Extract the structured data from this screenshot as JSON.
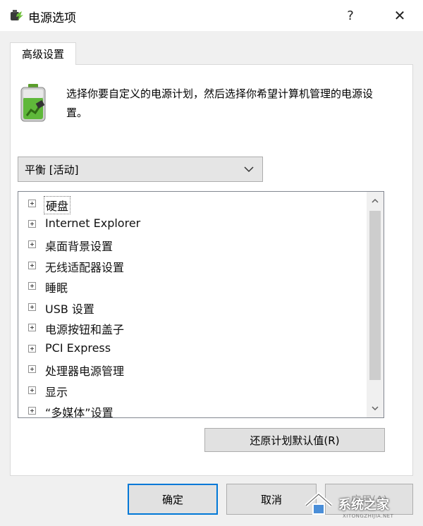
{
  "window": {
    "title": "电源选项",
    "help_label": "?",
    "close_label": "✕",
    "icon": "power-options-icon"
  },
  "tabs": [
    {
      "label": "高级设置",
      "active": true
    }
  ],
  "description": "选择你要自定义的电源计划，然后选择你希望计算机管理的电源设置。",
  "plan_select": {
    "value": "平衡 [活动]",
    "icon": "chevron-down-icon"
  },
  "settings_list": {
    "items": [
      {
        "label": "硬盘"
      },
      {
        "label": "Internet Explorer"
      },
      {
        "label": "桌面背景设置"
      },
      {
        "label": "无线适配器设置"
      },
      {
        "label": "睡眠"
      },
      {
        "label": "USB 设置"
      },
      {
        "label": "电源按钮和盖子"
      },
      {
        "label": "PCI Express"
      },
      {
        "label": "处理器电源管理"
      },
      {
        "label": "显示"
      },
      {
        "label": "“多媒体”设置"
      }
    ]
  },
  "buttons": {
    "restore_label": "还原计划默认值(R)",
    "ok_label": "确定",
    "cancel_label": "取消",
    "apply_label": "应用(A)"
  },
  "watermark": {
    "text": "系统之家",
    "sub": "XITONGZHIJIA.NET"
  },
  "colors": {
    "accent": "#0078d7",
    "dialog_bg": "#f0f0f0",
    "button_bg": "#e1e1e1"
  }
}
